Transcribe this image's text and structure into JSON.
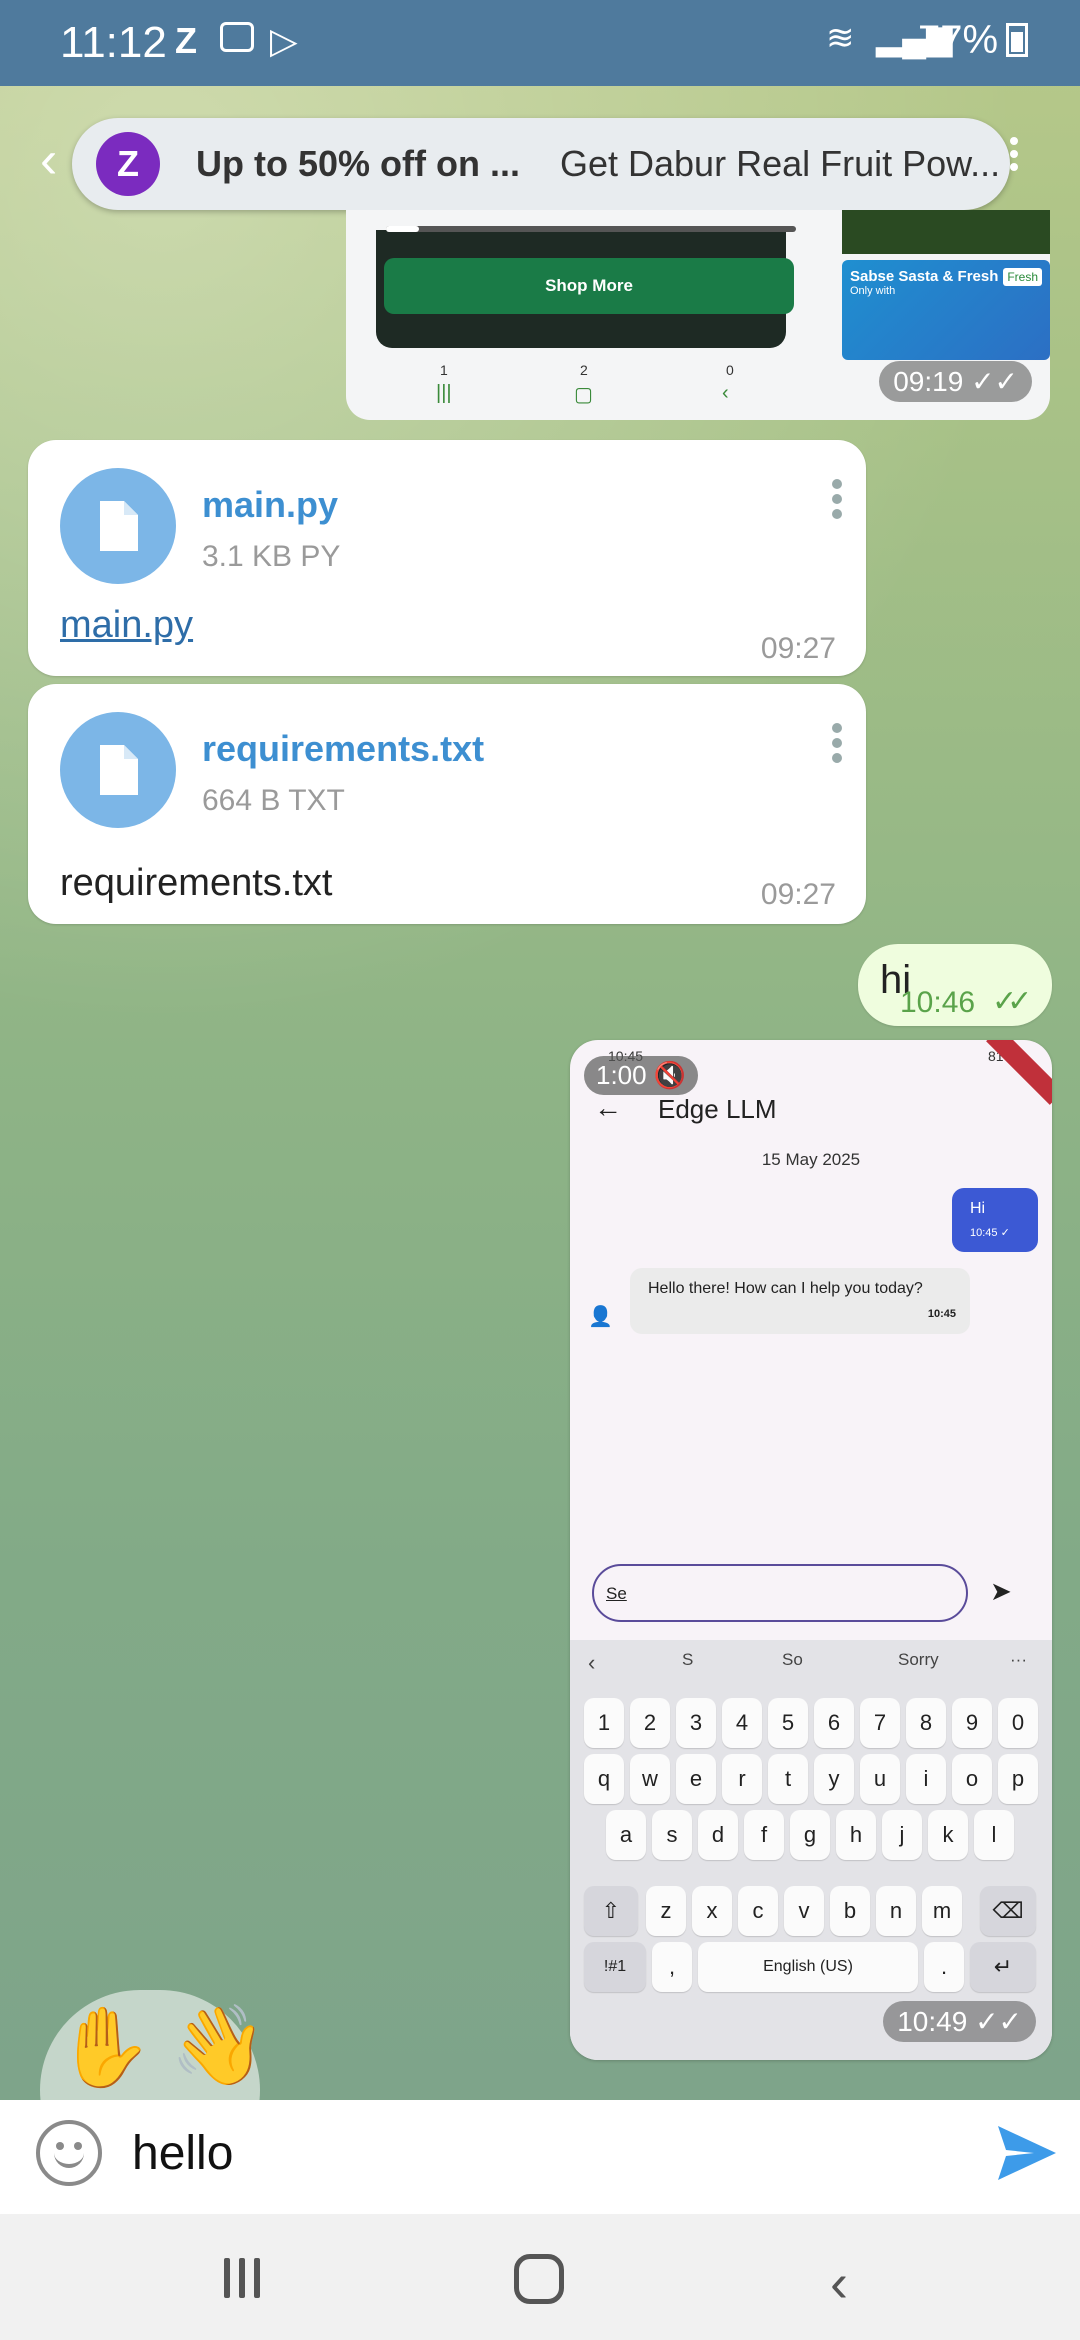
{
  "status_bar": {
    "time": "11:12",
    "battery": "77%"
  },
  "notification": {
    "avatar_letter": "Z",
    "title": "Up to 50% off on ...",
    "body": "Get Dabur Real Fruit Pow..."
  },
  "top_screenshot": {
    "shop_button": "Shop More",
    "nav_counts": [
      "1",
      "2",
      "0"
    ],
    "banner_title": "Sabse Sasta & Fresh",
    "banner_sub": "Only with",
    "banner_brand": "Fresh",
    "time": "09:19",
    "progress_fraction": 0.08
  },
  "files": [
    {
      "name": "main.py",
      "size": "3.1 KB PY",
      "caption": "main.py",
      "time": "09:27"
    },
    {
      "name": "requirements.txt",
      "size": "664 B TXT",
      "caption": "requirements.txt",
      "time": "09:27"
    }
  ],
  "hi_message": {
    "text": "hi",
    "time": "10:46"
  },
  "embedded_screenshot": {
    "status_time": "10:45",
    "status_battery": "81%",
    "video_time": "1:00",
    "title": "Edge LLM",
    "date": "15 May 2025",
    "out_msg": "Hi",
    "out_time": "10:45 ✓",
    "in_msg": "Hello there! How can I help you today?",
    "in_time": "10:45",
    "input_value": "Se",
    "suggestions": [
      "S",
      "So",
      "Sorry"
    ],
    "keys_row_nums": [
      "1",
      "2",
      "3",
      "4",
      "5",
      "6",
      "7",
      "8",
      "9",
      "0"
    ],
    "keys_row1": [
      "q",
      "w",
      "e",
      "r",
      "t",
      "y",
      "u",
      "i",
      "o",
      "p"
    ],
    "keys_row2": [
      "a",
      "s",
      "d",
      "f",
      "g",
      "h",
      "j",
      "k",
      "l"
    ],
    "keys_row3": [
      "z",
      "x",
      "c",
      "v",
      "b",
      "n",
      "m"
    ],
    "sym_key": "!#1",
    "comma_key": ",",
    "space_label": "English (US)",
    "period_key": ".",
    "time": "10:49"
  },
  "input_bar": {
    "value": "hello"
  }
}
